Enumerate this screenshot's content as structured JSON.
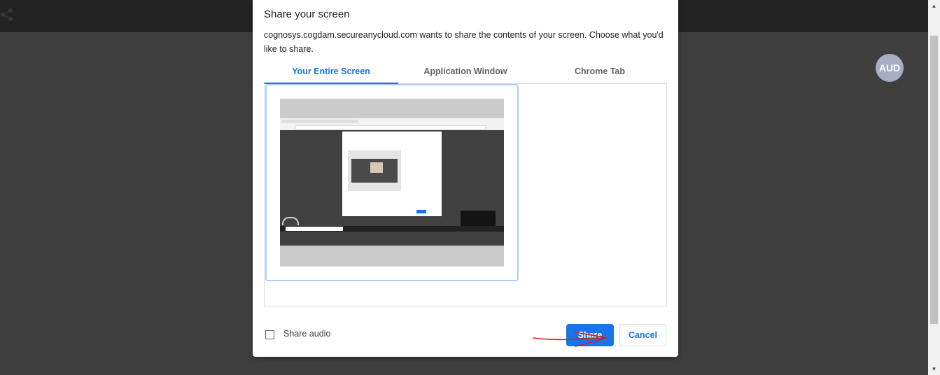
{
  "app": {
    "logo_icon": "share-nodes-icon",
    "avatar_text": "AUD"
  },
  "dialog": {
    "title": "Share your screen",
    "description": "cognosys.cogdam.secureanycloud.com wants to share the contents of your screen. Choose what you'd like to share.",
    "tabs": [
      {
        "label": "Your Entire Screen",
        "active": true
      },
      {
        "label": "Application Window",
        "active": false
      },
      {
        "label": "Chrome Tab",
        "active": false
      }
    ],
    "thumbnail_icon": "screen-preview",
    "share_audio_label": "Share audio",
    "share_audio_checked": false,
    "share_button": "Share",
    "cancel_button": "Cancel"
  },
  "annotation": {
    "arrow_color": "#d21f1f",
    "arrow_icon": "hand-drawn-arrow-icon"
  },
  "colors": {
    "accent": "#1a73e8",
    "background": "#3f3f3f",
    "topbar": "#232323"
  }
}
